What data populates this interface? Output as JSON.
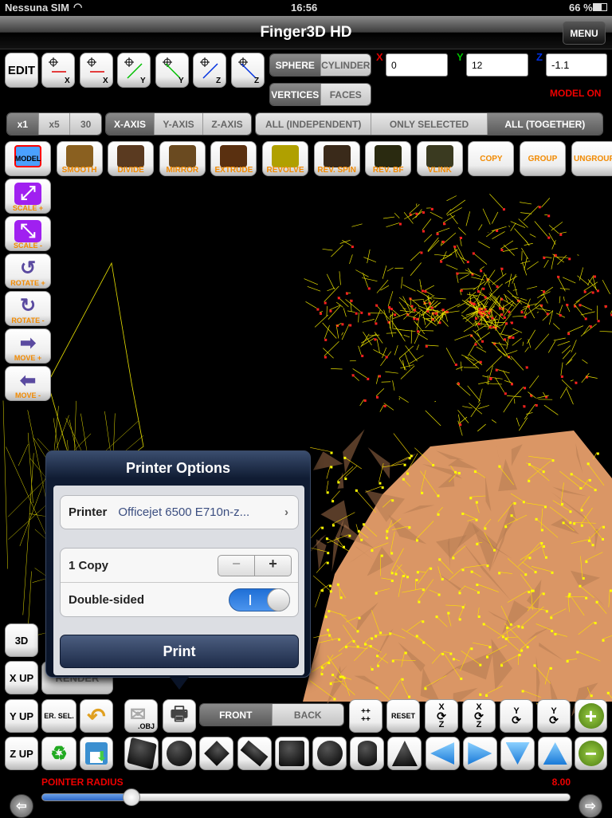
{
  "status": {
    "carrier": "Nessuna SIM",
    "time": "16:56",
    "battery": "66 %"
  },
  "nav": {
    "title": "Finger3D HD",
    "menu": "MENU"
  },
  "top": {
    "edit": "EDIT",
    "moves": [
      {
        "name": "move-x-minus",
        "axis": "X",
        "color": "#e00000"
      },
      {
        "name": "move-x-plus",
        "axis": "X",
        "color": "#e00000"
      },
      {
        "name": "move-y-minus",
        "axis": "Y",
        "color": "#00c000"
      },
      {
        "name": "move-y-plus",
        "axis": "Y",
        "color": "#00c000"
      },
      {
        "name": "move-z-minus",
        "axis": "Z",
        "color": "#0030e0"
      },
      {
        "name": "move-z-plus",
        "axis": "Z",
        "color": "#0030e0"
      }
    ],
    "shape_seg": [
      {
        "label": "SPHERE",
        "selected": true
      },
      {
        "label": "CYLINDER",
        "selected": false
      }
    ],
    "mode_seg": [
      {
        "label": "VERTICES",
        "selected": true
      },
      {
        "label": "FACES",
        "selected": false
      }
    ],
    "coords": [
      {
        "label": "X",
        "value": "0",
        "color": "#e00000"
      },
      {
        "label": "Y",
        "value": "12",
        "color": "#00c000"
      },
      {
        "label": "Z",
        "value": "-1.1",
        "color": "#0030e0"
      }
    ],
    "model_status": "MODEL ON"
  },
  "seg2": {
    "mult": [
      {
        "label": "x1",
        "selected": true
      },
      {
        "label": "x5",
        "selected": false
      },
      {
        "label": "30",
        "selected": false
      }
    ],
    "axis": [
      {
        "label": "X-AXIS",
        "selected": true
      },
      {
        "label": "Y-AXIS",
        "selected": false
      },
      {
        "label": "Z-AXIS",
        "selected": false
      }
    ],
    "scope": [
      {
        "label": "ALL (INDEPENDENT)",
        "selected": false
      },
      {
        "label": "ONLY SELECTED",
        "selected": false
      },
      {
        "label": "ALL (TOGETHER)",
        "selected": true
      }
    ]
  },
  "tools": [
    "MODEL",
    "SMOOTH",
    "DIVIDE",
    "MIRROR",
    "EXTRUDE",
    "REVOLVE",
    "REV. SPIN",
    "REV. BF",
    "VLINK",
    "COPY",
    "GROUP",
    "UNGROUP"
  ],
  "left_tools": [
    "SCALE +",
    "SCALE -",
    "ROTATE +",
    "ROTATE -",
    "MOVE +",
    "MOVE -"
  ],
  "popover": {
    "title": "Printer Options",
    "printer_label": "Printer",
    "printer_value": "Officejet 6500 E710n-z...",
    "copies": "1 Copy",
    "stepper_minus": "−",
    "stepper_plus": "+",
    "duplex_label": "Double-sided",
    "duplex_on": true,
    "print": "Print"
  },
  "bottom": {
    "view3d": "3D",
    "xup": "X UP",
    "yup": "Y UP",
    "zup": "Z UP",
    "render": "RENDER",
    "ersel": "ER. SEL.",
    "obj": ".OBJ",
    "face_seg": [
      {
        "label": "FRONT",
        "selected": true
      },
      {
        "label": "BACK",
        "selected": false
      }
    ],
    "reset": "RESET",
    "grid": "++\n++",
    "rotations": [
      {
        "top": "X",
        "bottom": "Z"
      },
      {
        "top": "X",
        "bottom": "Z"
      },
      {
        "top": "Y",
        "bottom": ""
      },
      {
        "top": "Y",
        "bottom": ""
      }
    ],
    "primitives": [
      "plane",
      "sphere",
      "diamond",
      "box-slab",
      "cube",
      "geosphere",
      "cylinder",
      "cone",
      "arrow-left",
      "arrow-right",
      "arrow-down",
      "arrow-up"
    ]
  },
  "slider": {
    "label": "POINTER RADIUS",
    "value": "8.00",
    "fraction": 0.17
  }
}
